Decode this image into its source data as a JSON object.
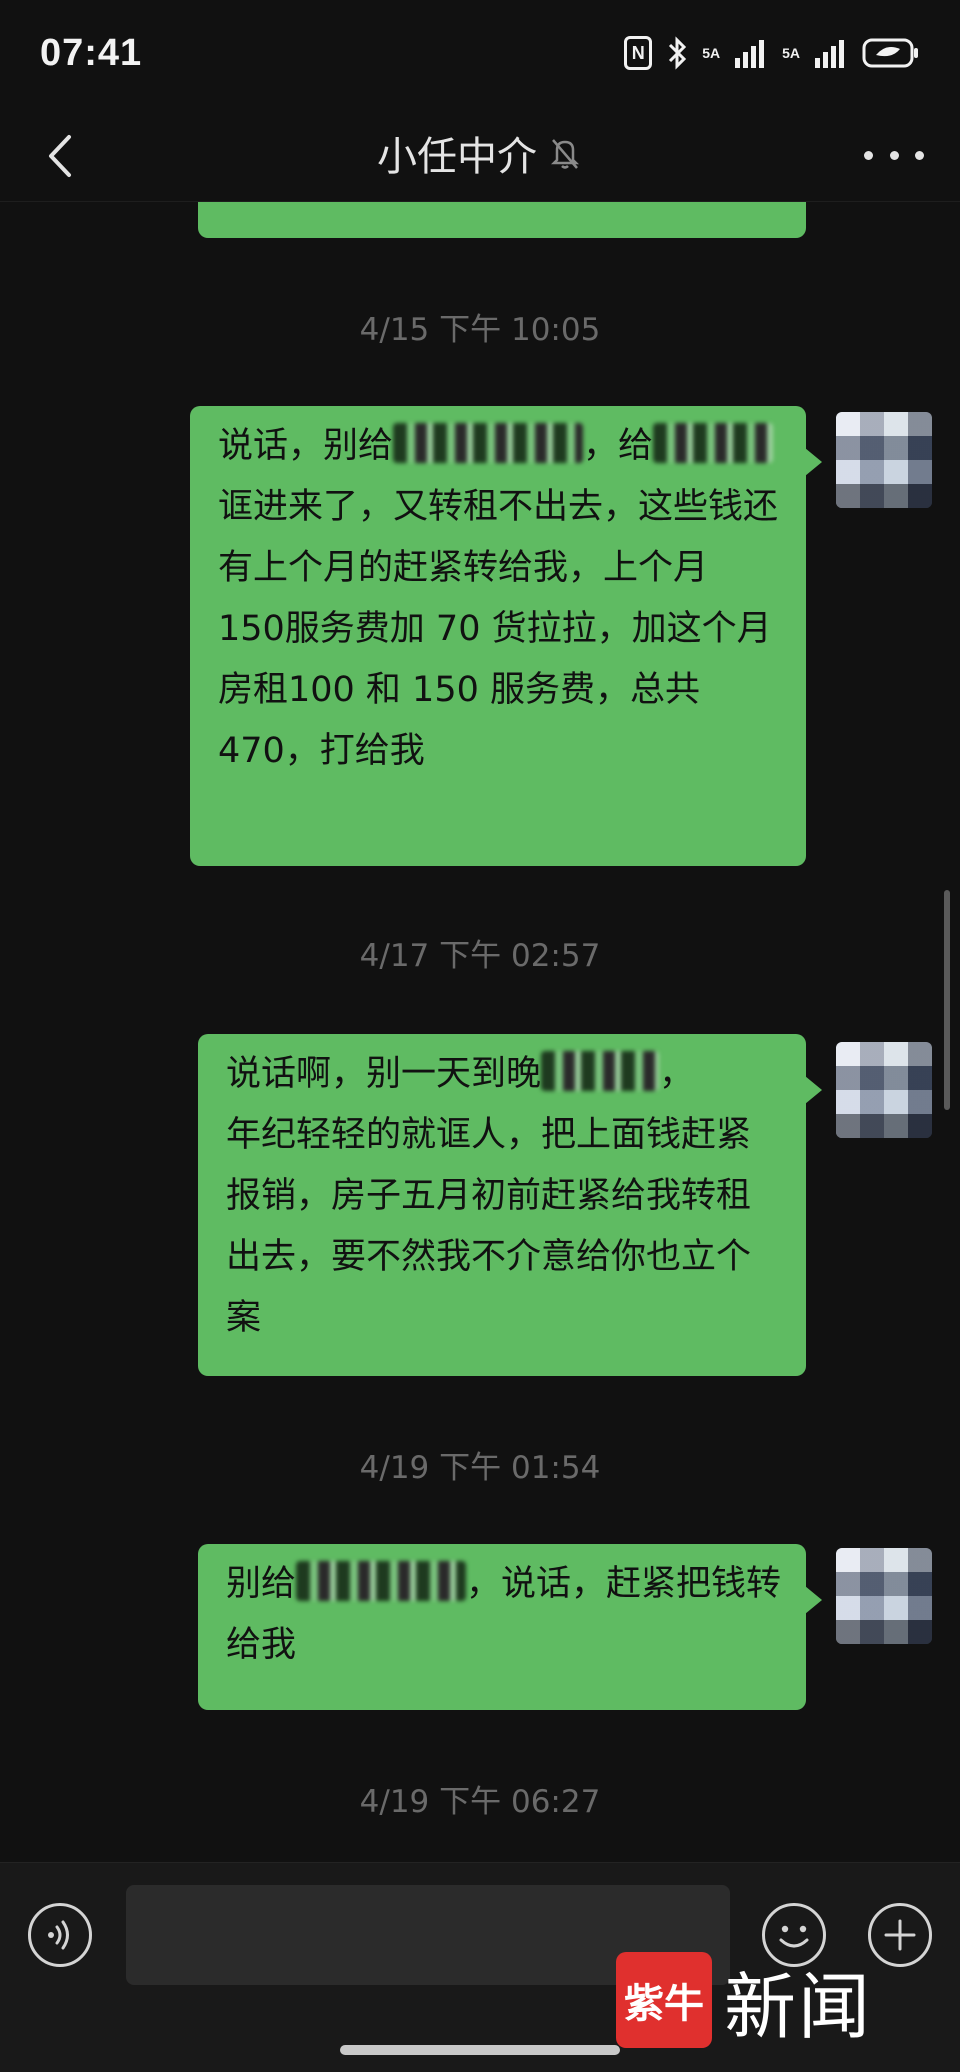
{
  "status_bar": {
    "time": "07:41",
    "nfc": "N",
    "net1": "5A",
    "net2": "5A"
  },
  "header": {
    "title": "小任中介"
  },
  "messages": [
    {
      "timestamp": "4/15 下午 10:05",
      "text_parts": [
        "说话，别给",
        "，给",
        "\n诓进来了，又转租不出去，这些钱还有上个月的赶紧转给我，上个月 150服务费加 70 货拉拉，加这个月房租100 和 150 服务费，总共 470，打给我"
      ]
    },
    {
      "timestamp": "4/17 下午 02:57",
      "text_parts": [
        "说话啊，别一天到晚",
        "，\n年纪轻轻的就诓人，把上面钱赶紧报销，房子五月初前赶紧给我转租出去，要不然我不介意给你也立个案"
      ]
    },
    {
      "timestamp": "4/19 下午 01:54",
      "text_parts": [
        "别给",
        "，说话，赶紧把钱转给我"
      ]
    },
    {
      "timestamp": "4/19 下午 06:27"
    }
  ],
  "colors": {
    "bubble": "#5fbb62",
    "background": "#111111",
    "watermark_red": "#e0302e"
  },
  "watermark": {
    "logo": "紫牛",
    "text": "新闻"
  }
}
